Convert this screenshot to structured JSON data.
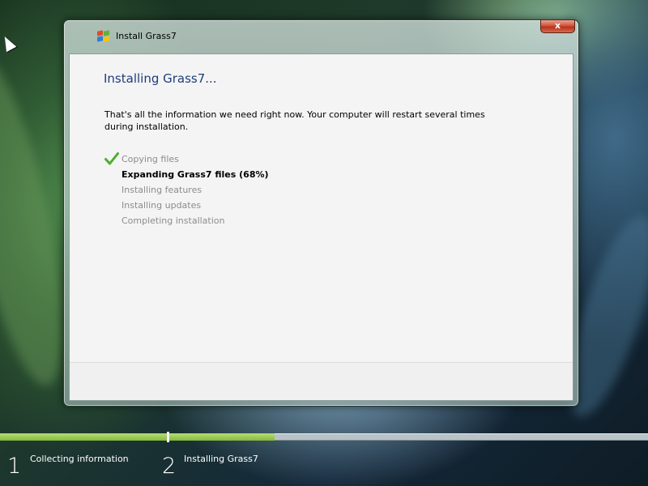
{
  "window": {
    "title": "Install Grass7",
    "close_symbol": "x",
    "icon": "windows-logo-icon"
  },
  "content": {
    "heading": "Installing Grass7...",
    "info": "That's all the information we need right now. Your computer will restart several times during installation."
  },
  "steps": [
    {
      "label": "Copying files",
      "status": "done"
    },
    {
      "label": "Expanding Grass7 files (68%)",
      "status": "active"
    },
    {
      "label": "Installing features",
      "status": "pending"
    },
    {
      "label": "Installing updates",
      "status": "pending"
    },
    {
      "label": "Completing installation",
      "status": "pending"
    }
  ],
  "phases": [
    {
      "number": "1",
      "label": "Collecting information",
      "progress": 1.0
    },
    {
      "number": "2",
      "label": "Installing Grass7",
      "progress": 0.22
    }
  ],
  "colors": {
    "heading": "#1e3d78",
    "progress": "#86b83e",
    "check": "#4cae2f",
    "close_button": "#c8432a"
  }
}
